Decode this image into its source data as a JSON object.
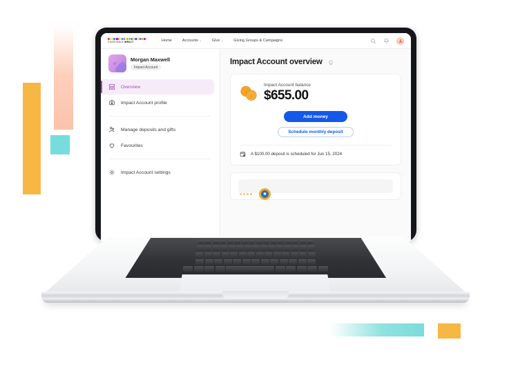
{
  "brand": {
    "name_light": "CHARITABLE ",
    "name_bold": "IMPACT",
    "pixel_colors": [
      "#e8453c",
      "#f5a623",
      "#f8e71c",
      "#7ed321",
      "#4a90d9",
      "#9013fe",
      "#e8453c",
      "#f5a623",
      "#50e3c2",
      "#4a90d9",
      "#bd10e0",
      "#f8e71c",
      "#7ed321",
      "#e8453c",
      "#4a90d9",
      "#f5a623",
      "#50e3c2",
      "#9013fe",
      "#f8e71c",
      "#7ed321",
      "#4a90d9",
      "#e8453c",
      "#bd10e0",
      "#f5a623"
    ]
  },
  "topnav": {
    "items": [
      {
        "label": "Home",
        "has_caret": false
      },
      {
        "label": "Accounts",
        "has_caret": true
      },
      {
        "label": "Give",
        "has_caret": true
      },
      {
        "label": "Giving Groups & Campaigns",
        "has_caret": false
      }
    ],
    "caret_glyph": "⌄",
    "search_icon": "search-icon",
    "bell_icon": "bell-icon",
    "avatar_icon": "user-avatar"
  },
  "sidebar": {
    "profile": {
      "name": "Morgan Maxwell",
      "badge": "Impact Account"
    },
    "items": [
      {
        "label": "Overview",
        "icon": "dashboard-grid-icon",
        "active": true
      },
      {
        "label": "Impact Account profile",
        "icon": "account-profile-icon",
        "active": false
      },
      {
        "label": "Manage deposits and gifts",
        "icon": "hand-coin-icon",
        "active": false
      },
      {
        "label": "Favourites",
        "icon": "heart-icon",
        "active": false
      },
      {
        "label": "Impact Account settings",
        "icon": "gear-icon",
        "active": false
      }
    ]
  },
  "main": {
    "page_title": "Impact Account overview",
    "title_icon": "lightbulb-icon",
    "balance_card": {
      "icon": "coins-icon",
      "label": "Impact Account balance",
      "amount": "$655.00",
      "primary_button": "Add money",
      "secondary_button": "Schedule monthly deposit",
      "notice_icon": "calendar-scheduled-icon",
      "notice_text": "A $100.00 deposit is scheduled for Jun 15, 2024"
    },
    "next_card": {
      "badge_icon": "circular-avatar-icon"
    }
  },
  "colors": {
    "accent_purple": "#9b4fbf",
    "accent_blue": "#1358e8",
    "coin_orange": "#f5a623",
    "deco_amber": "#f7b745",
    "deco_peach": "#fcc2ab",
    "deco_teal": "#7adcda"
  }
}
